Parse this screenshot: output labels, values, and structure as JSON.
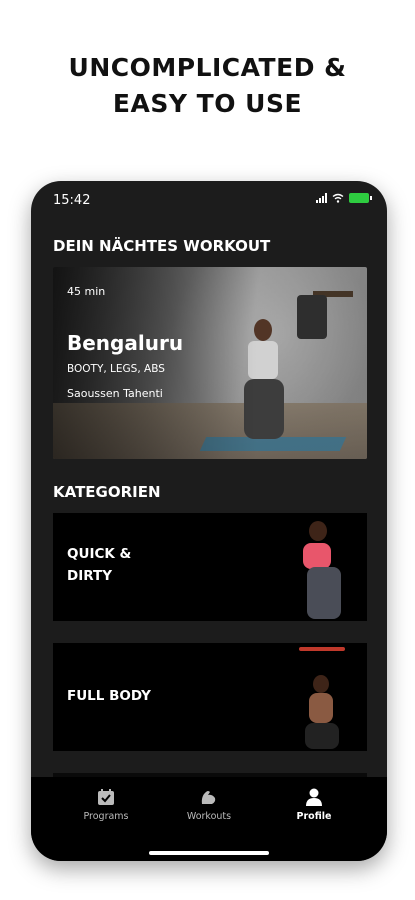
{
  "headline": {
    "line1": "UNCOMPLICATED &",
    "line2": "EASY TO USE"
  },
  "status": {
    "time": "15:42",
    "icons": [
      "signal-icon",
      "wifi-icon",
      "battery-icon"
    ],
    "battery_color": "#2ecc40"
  },
  "next_workout": {
    "section_title": "DEIN NÄCHTES WORKOUT",
    "duration": "45 min",
    "title": "Bengaluru",
    "tags": "BOOTY, LEGS, ABS",
    "trainer": "Saoussen Tahenti"
  },
  "categories": {
    "section_title": "KATEGORIEN",
    "items": [
      {
        "label_line1": "QUICK &",
        "label_line2": "DIRTY"
      },
      {
        "label_line1": "FULL BODY",
        "label_line2": ""
      }
    ]
  },
  "tabbar": {
    "items": [
      {
        "label": "Programs",
        "icon": "calendar-icon"
      },
      {
        "label": "Workouts",
        "icon": "bicep-icon"
      },
      {
        "label": "Profile",
        "icon": "person-icon",
        "active": true
      }
    ]
  },
  "colors": {
    "app_background": "#1c1c1c",
    "card_background": "#000000",
    "accent_active": "#ffffff"
  }
}
